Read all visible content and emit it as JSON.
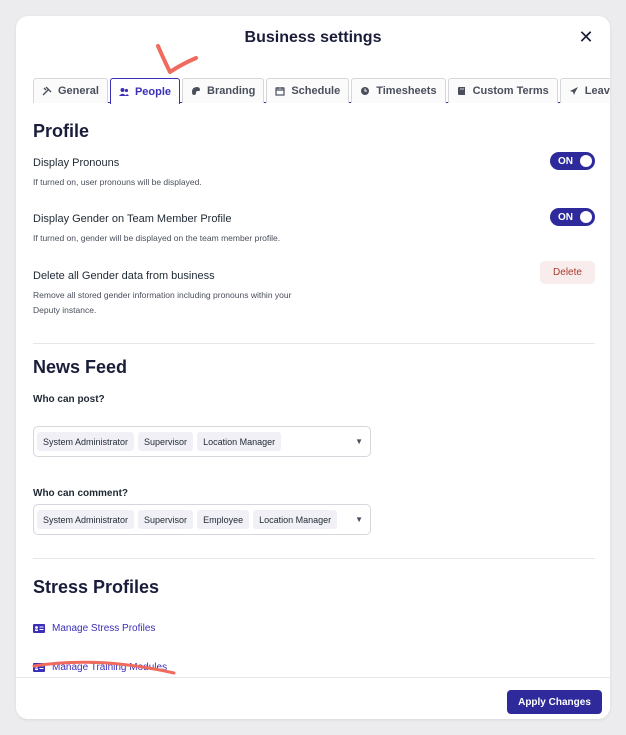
{
  "modal": {
    "title": "Business settings",
    "close_glyph": "✕"
  },
  "tabs": [
    {
      "label": "General",
      "icon": "tools-icon",
      "active": false
    },
    {
      "label": "People",
      "icon": "people-icon",
      "active": true
    },
    {
      "label": "Branding",
      "icon": "palette-icon",
      "active": false
    },
    {
      "label": "Schedule",
      "icon": "calendar-icon",
      "active": false
    },
    {
      "label": "Timesheets",
      "icon": "clock-icon",
      "active": false
    },
    {
      "label": "Custom Terms",
      "icon": "book-icon",
      "active": false
    },
    {
      "label": "Leave",
      "icon": "plane-icon",
      "active": false
    }
  ],
  "profile": {
    "title": "Profile",
    "pronouns": {
      "label": "Display Pronouns",
      "help": "If turned on, user pronouns will be displayed.",
      "toggle": "ON"
    },
    "gender": {
      "label": "Display Gender on Team Member Profile",
      "help": "If turned on, gender will be displayed on the team member profile.",
      "toggle": "ON"
    },
    "delete_gender": {
      "label": "Delete all Gender data from business",
      "help_line1": "Remove all stored gender information including pronouns within your",
      "help_line2": "Deputy instance.",
      "button": "Delete"
    }
  },
  "news_feed": {
    "title": "News Feed",
    "post": {
      "label": "Who can post?",
      "chips": [
        "System Administrator",
        "Supervisor",
        "Location Manager"
      ]
    },
    "comment": {
      "label": "Who can comment?",
      "chips": [
        "System Administrator",
        "Supervisor",
        "Employee",
        "Location Manager"
      ]
    }
  },
  "stress_profiles": {
    "title": "Stress Profiles",
    "links": [
      "Manage Stress Profiles",
      "Manage Training Modules"
    ]
  },
  "footer": {
    "apply_label": "Apply Changes"
  },
  "colors": {
    "accent": "#2e2a9c",
    "link": "#3b2fb8",
    "delete_text": "#a53b2e",
    "annotation": "#f06a5e"
  }
}
